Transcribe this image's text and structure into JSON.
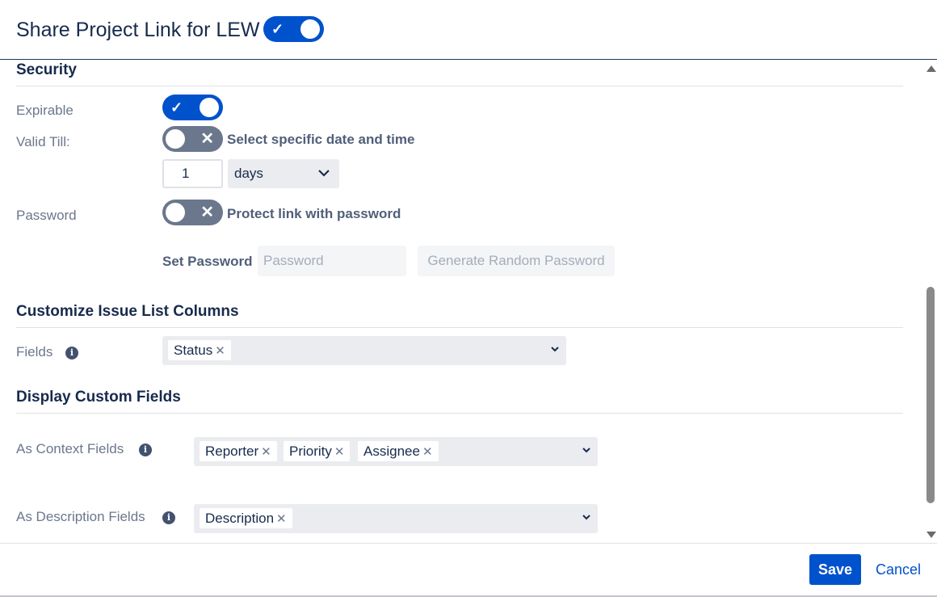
{
  "header": {
    "title": "Share Project Link for LEW",
    "share_enabled": true
  },
  "security": {
    "title": "Security",
    "expirable": {
      "label": "Expirable",
      "enabled": true
    },
    "valid_till": {
      "label": "Valid Till:",
      "toggle_text": "Select specific date and time",
      "enabled": false,
      "amount": "1",
      "unit": "days"
    },
    "password": {
      "label": "Password",
      "toggle_text": "Protect link with password",
      "enabled": false,
      "set_label": "Set Password",
      "placeholder": "Password",
      "generate_label": "Generate Random Password"
    }
  },
  "columns": {
    "title": "Customize Issue List Columns",
    "fields_label": "Fields",
    "fields": [
      "Status"
    ]
  },
  "custom": {
    "title": "Display Custom Fields",
    "context_label": "As Context Fields",
    "context_fields": [
      "Reporter",
      "Priority",
      "Assignee"
    ],
    "description_label": "As Description Fields",
    "description_fields": [
      "Description"
    ]
  },
  "footer": {
    "save_label": "Save",
    "cancel_label": "Cancel"
  },
  "icons": {
    "check": "check-icon",
    "cross": "cross-icon",
    "info": "info-icon",
    "chevron": "chevron-down-icon"
  },
  "colors": {
    "primary": "#0052cc",
    "toggle_off": "#6b778c"
  }
}
